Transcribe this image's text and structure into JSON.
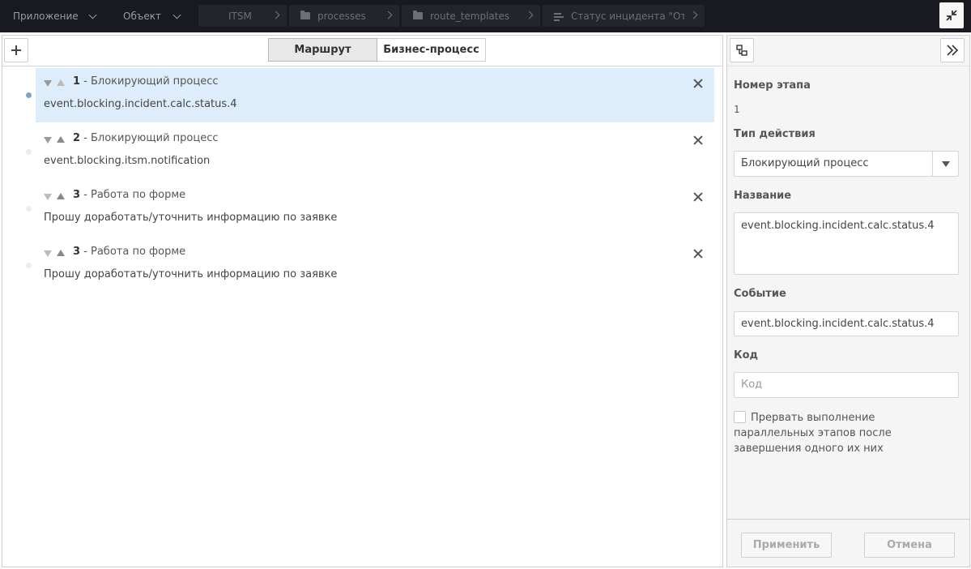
{
  "topbar": {
    "app_menu": "Приложение",
    "object_menu": "Объект",
    "breadcrumbs": [
      {
        "label": "ITSM",
        "icon": "none"
      },
      {
        "label": "processes",
        "icon": "folder-icon"
      },
      {
        "label": "route_templates",
        "icon": "folder-icon"
      },
      {
        "label": "Статус инцидента \"От...",
        "icon": "route-icon"
      }
    ]
  },
  "toolbar": {
    "tab_route": "Маршрут",
    "tab_business": "Бизнес-процесс"
  },
  "stages": [
    {
      "number": "1",
      "type": " - Блокирующий процесс",
      "description": "event.blocking.incident.calc.status.4",
      "selected": true
    },
    {
      "number": "2",
      "type": " - Блокирующий процесс",
      "description": "event.blocking.itsm.notification",
      "selected": false
    },
    {
      "number": "3",
      "type": " - Работа по форме",
      "description": "Прошу доработать/уточнить информацию по заявке",
      "selected": false
    },
    {
      "number": "3",
      "type": " - Работа по форме",
      "description": "Прошу доработать/уточнить информацию по заявке",
      "selected": false
    }
  ],
  "side": {
    "stage_number_label": "Номер этапа",
    "stage_number_value": "1",
    "action_type_label": "Тип действия",
    "action_type_value": "Блокирующий процесс",
    "name_label": "Название",
    "name_value": "event.blocking.incident.calc.status.4",
    "event_label": "Событие",
    "event_value": "event.blocking.incident.calc.status.4",
    "code_label": "Код",
    "code_placeholder": "Код",
    "interrupt_label": "Прервать выполнение параллельных этапов после завершения одного их них",
    "apply_button": "Применить",
    "cancel_button": "Отмена"
  },
  "colors": {
    "topbar_bg": "#181a20",
    "selected_row": "#deedfb",
    "active_dot": "#7ea4c4"
  }
}
